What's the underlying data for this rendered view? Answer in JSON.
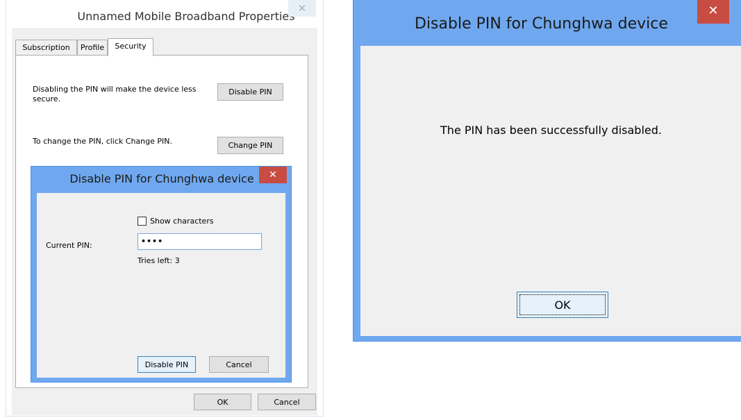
{
  "props_window": {
    "title": "Unnamed Mobile Broadband Properties",
    "close_icon": "close-icon",
    "tabs": [
      {
        "label": "Subscription"
      },
      {
        "label": "Profile"
      },
      {
        "label": "Security"
      }
    ],
    "active_tab": "Security",
    "disable_text": "Disabling the PIN will make the device less secure.",
    "disable_button": "Disable PIN",
    "change_text": "To change the PIN, click Change PIN.",
    "change_button": "Change PIN",
    "ok_button": "OK",
    "cancel_button": "Cancel"
  },
  "pin_dialog": {
    "title": "Disable PIN for Chunghwa device",
    "show_characters_label": "Show characters",
    "current_pin_label": "Current PIN:",
    "pin_value": "••••",
    "tries_left": "Tries left: 3",
    "disable_button": "Disable PIN",
    "cancel_button": "Cancel"
  },
  "result_dialog": {
    "title": "Disable PIN for Chunghwa device",
    "message": "The PIN has been successfully disabled.",
    "ok_button": "OK"
  },
  "colors": {
    "titlebar_active": "#6fa8ef",
    "close_active": "#c94c42",
    "client_bg": "#f0f0f0"
  }
}
